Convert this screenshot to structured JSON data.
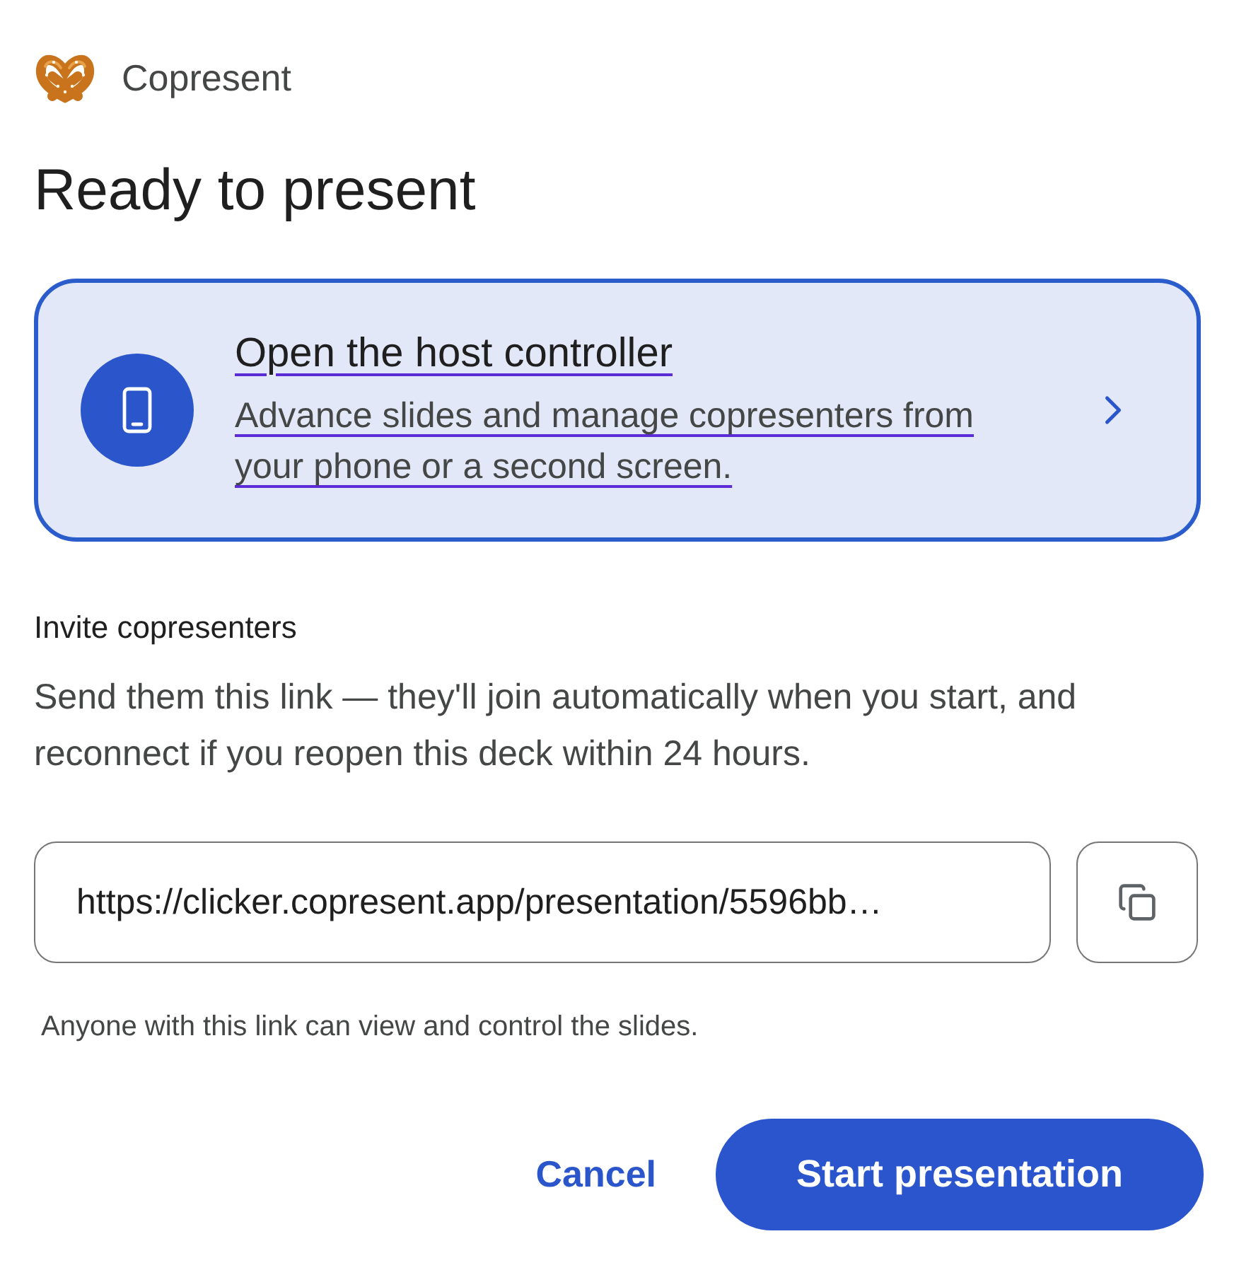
{
  "app": {
    "name": "Copresent"
  },
  "title": "Ready to present",
  "host_controller": {
    "title": "Open the host controller",
    "description": "Advance slides and manage copresenters from your phone or a second screen."
  },
  "invite": {
    "heading": "Invite copresenters",
    "text": "Send them this link — they'll join automatically when you start, and reconnect if you reopen this deck within 24 hours.",
    "link_field": {
      "value": "https://clicker.copresent.app/presentation/5596bb…"
    },
    "note": "Anyone with this link can view and control the slides."
  },
  "buttons": [
    {
      "label": "Cancel",
      "kind": "text"
    },
    {
      "label": "Start presentation",
      "kind": "primary"
    }
  ]
}
